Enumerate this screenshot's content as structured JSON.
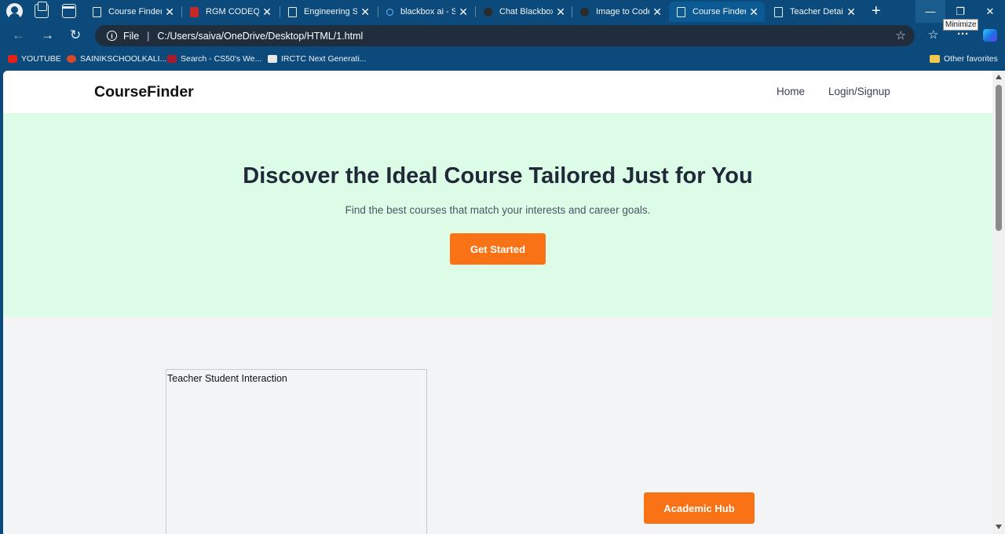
{
  "browser": {
    "tabs": [
      {
        "title": "Course Finder",
        "icon": "page-icon",
        "active": false
      },
      {
        "title": "RGM CODEQUEST",
        "icon": "pdf-icon",
        "active": false
      },
      {
        "title": "Engineering Subjects",
        "icon": "page-icon",
        "active": false
      },
      {
        "title": "blackbox ai - Search",
        "icon": "search-icon",
        "active": false
      },
      {
        "title": "Chat Blackbox: AI",
        "icon": "blackbox-icon",
        "active": false
      },
      {
        "title": "Image to Code",
        "icon": "blackbox-icon",
        "active": false
      },
      {
        "title": "Course Finder",
        "icon": "page-icon",
        "active": true
      },
      {
        "title": "Teacher Details",
        "icon": "page-icon",
        "active": false
      }
    ],
    "tooltip": "Minimize",
    "address": {
      "scheme": "File",
      "url": "C:/Users/saiva/OneDrive/Desktop/HTML/1.html"
    },
    "bookmarks": [
      {
        "label": "YOUTUBE",
        "icon": "youtube-icon"
      },
      {
        "label": "SAINIKSCHOOLKALI...",
        "icon": "school-icon"
      },
      {
        "label": "Search - CS50's We...",
        "icon": "harvard-icon"
      },
      {
        "label": "IRCTC Next Generati...",
        "icon": "irctc-icon"
      }
    ],
    "other_favorites": "Other favorites"
  },
  "page": {
    "brand": "CourseFinder",
    "nav": {
      "home": "Home",
      "login": "Login/Signup"
    },
    "hero": {
      "title": "Discover the Ideal Course Tailored Just for You",
      "subtitle": "Find the best courses that match your interests and career goals.",
      "cta": "Get Started"
    },
    "image_alt": "Teacher Student Interaction",
    "hub_button": "Academic Hub"
  }
}
